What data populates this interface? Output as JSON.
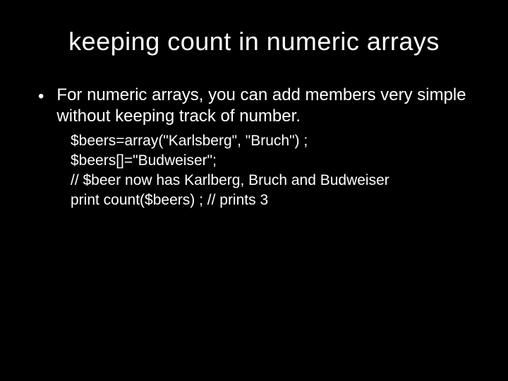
{
  "title": "keeping count in  numeric arrays",
  "bullet": {
    "text": "For numeric arrays, you can add members very simple without keeping track of number."
  },
  "code": {
    "lines": [
      "$beers=array(\"Karlsberg\", \"Bruch\") ;",
      "$beers[]=\"Budweiser\";",
      "// $beer now has Karlberg, Bruch and Budweiser",
      "print count($beers) ; // prints 3"
    ]
  }
}
